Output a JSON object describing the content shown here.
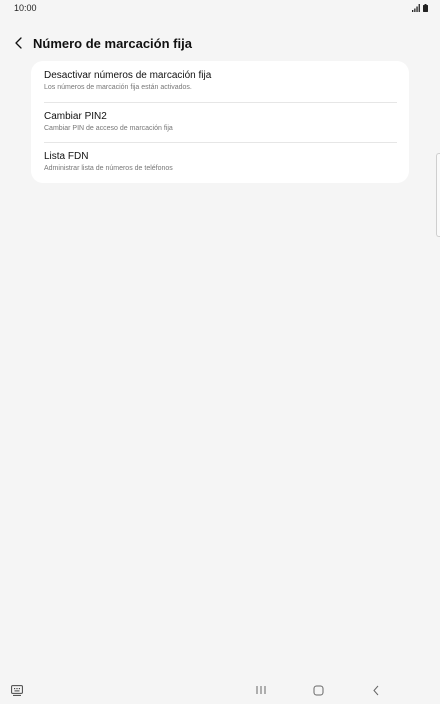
{
  "status_bar": {
    "time": "10:00",
    "icons": [
      "signal-icon",
      "battery-icon"
    ]
  },
  "header": {
    "title": "Número de marcación fija",
    "back_icon": "chevron-left-icon"
  },
  "items": [
    {
      "title": "Desactivar números de marcación fija",
      "subtitle": "Los números de marcación fija están activados."
    },
    {
      "title": "Cambiar PIN2",
      "subtitle": "Cambiar PIN de acceso de marcación fija"
    },
    {
      "title": "Lista FDN",
      "subtitle": "Administrar lista de números de teléfonos"
    }
  ],
  "nav_bar": {
    "icons": [
      "keyboard-switch-icon",
      "recents-icon",
      "home-icon",
      "back-icon"
    ]
  },
  "colors": {
    "background": "#f5f5f5",
    "card": "#ffffff",
    "divider": "#e6e6e6"
  }
}
